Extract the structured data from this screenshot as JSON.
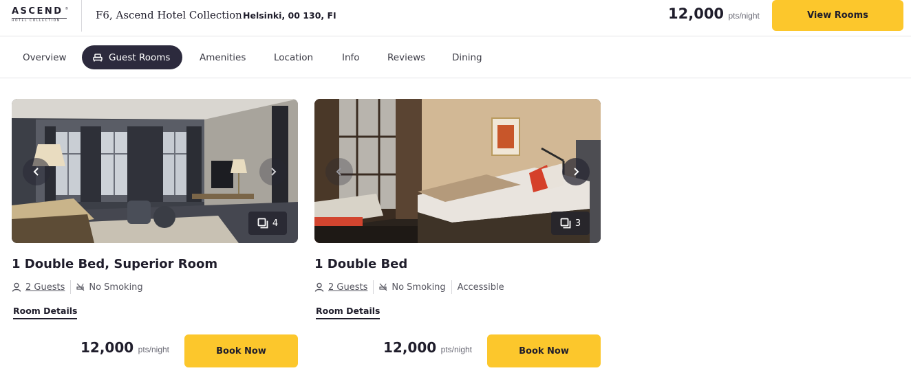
{
  "brand": {
    "logo_word": "ASCEND",
    "logo_reg": "®",
    "logo_sub": "HOTEL COLLECTION"
  },
  "header": {
    "hotel_name": "F6, Ascend Hotel Collection",
    "address": "Helsinki, 00 130, FI",
    "price": "12,000",
    "price_unit": "pts/night",
    "view_rooms_label": "View Rooms"
  },
  "tabs": [
    {
      "label": "Overview",
      "active": false
    },
    {
      "label": "Guest Rooms",
      "active": true,
      "icon": "bed-icon"
    },
    {
      "label": "Amenities",
      "active": false
    },
    {
      "label": "Location",
      "active": false
    },
    {
      "label": "Info",
      "active": false
    },
    {
      "label": "Reviews",
      "active": false
    },
    {
      "label": "Dining",
      "active": false
    }
  ],
  "rooms": [
    {
      "title": "1 Double Bed, Superior Room",
      "photo_count": "4",
      "guests": "2 Guests",
      "smoking": "No Smoking",
      "details_label": "Room Details",
      "price": "12,000",
      "price_unit": "pts/night",
      "book_label": "Book Now"
    },
    {
      "title": "1 Double Bed",
      "photo_count": "3",
      "guests": "2 Guests",
      "smoking": "No Smoking",
      "accessible": "Accessible",
      "details_label": "Room Details",
      "price": "12,000",
      "price_unit": "pts/night",
      "book_label": "Book Now"
    }
  ],
  "colors": {
    "accent_yellow": "#fcc72c",
    "dark": "#1f1d2b",
    "tab_active_bg": "#2c2a3d"
  }
}
